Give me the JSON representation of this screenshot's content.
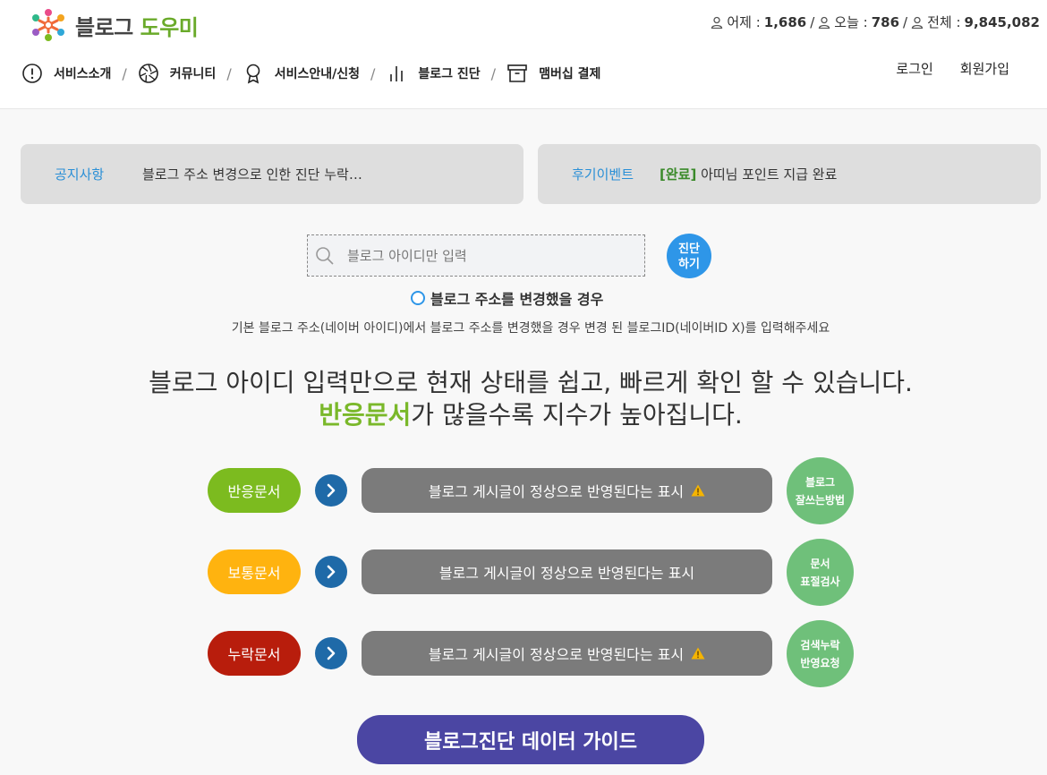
{
  "logo": {
    "part1": "블로그",
    "part2": "도우미"
  },
  "stats": {
    "yesterday_label": "어제 :",
    "yesterday": "1,686",
    "today_label": "오늘 :",
    "today": "786",
    "total_label": "전체 :",
    "total": "9,845,082",
    "sep": "/"
  },
  "nav": {
    "items": [
      {
        "label": "서비스소개",
        "icon": "exclamation-circle-icon"
      },
      {
        "label": "커뮤니티",
        "icon": "aperture-icon"
      },
      {
        "label": "서비스안내/신청",
        "icon": "award-ribbon-icon"
      },
      {
        "label": "블로그 진단",
        "icon": "bar-chart-icon"
      },
      {
        "label": "맴버십 결제",
        "icon": "archive-box-icon"
      }
    ],
    "separator": "/"
  },
  "auth": {
    "login": "로그인",
    "signup": "회원가입"
  },
  "notices": {
    "left": {
      "label": "공지사항",
      "text": "블로그 주소 변경으로 인한 진단 누락…"
    },
    "right": {
      "label": "후기이벤트",
      "bracket": "[완료]",
      "text": " 아띠님 포인트 지급 완료"
    }
  },
  "search": {
    "placeholder": "블로그 아이디만 입력",
    "button_line1": "진단",
    "button_line2": "하기"
  },
  "change": {
    "option": "블로그 주소를 변경했을 경우",
    "desc": "기본 블로그 주소(네이버 아이디)에서 블로그 주소를 변경했을 경우 변경 된 블로그ID(네이버ID X)를 입력해주세요"
  },
  "headline": {
    "line1": "블로그 아이디 입력만으로 현재 상태를 쉽고, 빠르게 확인 할 수 있습니다.",
    "highlight": "반응문서",
    "line2_rest": "가 많을수록 지수가 높아집니다."
  },
  "rows": [
    {
      "pill": "반응문서",
      "color": "#7cbb1f",
      "bar": "블로그 게시글이 정상으로 반영된다는 표시",
      "warn": true,
      "circle1": "블로그",
      "circle2": "잘쓰는방법"
    },
    {
      "pill": "보통문서",
      "color": "#ffb30f",
      "bar": "블로그 게시글이 정상으로 반영된다는 표시",
      "warn": false,
      "circle1": "문서",
      "circle2": "표절검사"
    },
    {
      "pill": "누락문서",
      "color": "#b81d0c",
      "bar": "블로그 게시글이 정상으로 반영된다는 표시",
      "warn": true,
      "circle1": "검색누락",
      "circle2": "반영요청"
    }
  ],
  "guide_button": "블로그진단 데이터 가이드"
}
